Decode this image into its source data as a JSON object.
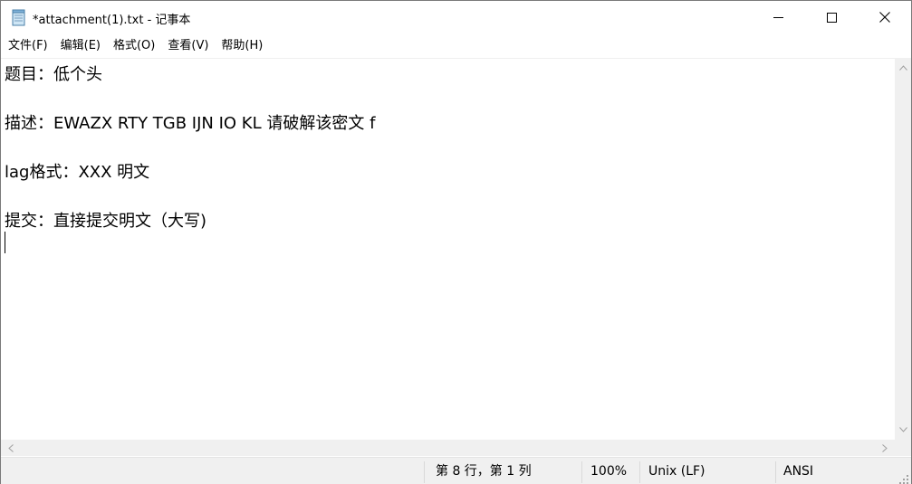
{
  "window": {
    "title": "*attachment(1).txt - 记事本",
    "icon": "notepad-icon"
  },
  "controls": {
    "minimize_icon": "minimize-icon",
    "maximize_icon": "maximize-icon",
    "close_icon": "close-icon"
  },
  "menu": {
    "items": [
      {
        "label": "文件(F)"
      },
      {
        "label": "编辑(E)"
      },
      {
        "label": "格式(O)"
      },
      {
        "label": "查看(V)"
      },
      {
        "label": "帮助(H)"
      }
    ]
  },
  "document": {
    "lines": [
      "题目：低个头",
      "",
      "描述：EWAZX RTY TGB IJN IO KL 请破解该密文 f",
      "",
      "lag格式：XXX 明文",
      "",
      "提交：直接提交明文（大写)",
      ""
    ]
  },
  "status": {
    "position": "第 8 行，第 1 列",
    "zoom": "100%",
    "line_ending": "Unix (LF)",
    "encoding": "ANSI"
  }
}
